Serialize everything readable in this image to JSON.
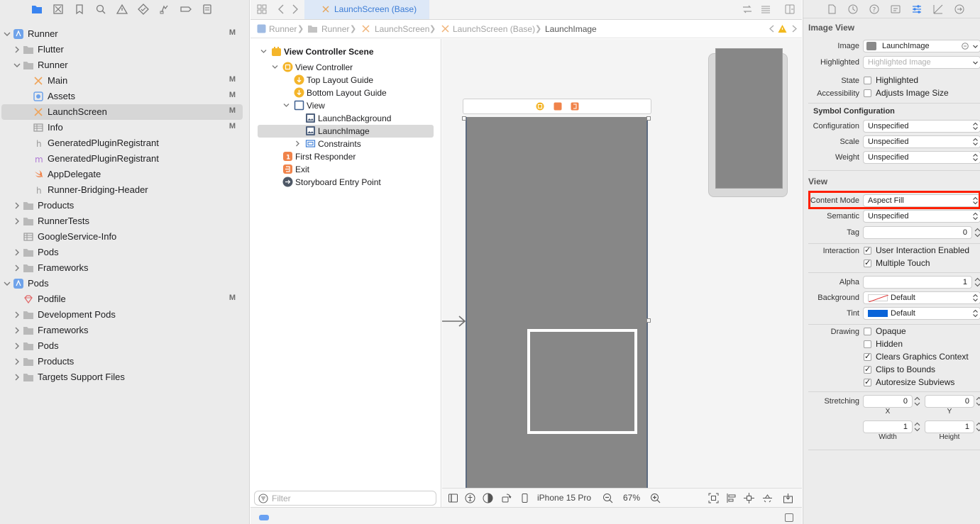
{
  "navigator": {
    "toolbar_icons": [
      "folder-icon",
      "source-control-icon",
      "bookmark-icon",
      "find-icon",
      "issue-icon",
      "test-icon",
      "debug-icon",
      "breakpoint-icon",
      "report-icon"
    ],
    "items": [
      {
        "label": "Runner",
        "badge": "M",
        "icon": "project-icon"
      },
      {
        "label": "Flutter",
        "badge": "",
        "icon": "folder-icon"
      },
      {
        "label": "Runner",
        "badge": "",
        "icon": "folder-icon"
      },
      {
        "label": "Main",
        "badge": "M",
        "icon": "storyboard-icon"
      },
      {
        "label": "Assets",
        "badge": "M",
        "icon": "asset-catalog-icon"
      },
      {
        "label": "LaunchScreen",
        "badge": "M",
        "icon": "storyboard-icon"
      },
      {
        "label": "Info",
        "badge": "M",
        "icon": "plist-icon"
      },
      {
        "label": "GeneratedPluginRegistrant",
        "badge": "",
        "icon": "header-file-icon"
      },
      {
        "label": "GeneratedPluginRegistrant",
        "badge": "",
        "icon": "objc-file-icon"
      },
      {
        "label": "AppDelegate",
        "badge": "",
        "icon": "swift-file-icon"
      },
      {
        "label": "Runner-Bridging-Header",
        "badge": "",
        "icon": "header-file-icon"
      },
      {
        "label": "Products",
        "badge": "",
        "icon": "folder-icon"
      },
      {
        "label": "RunnerTests",
        "badge": "",
        "icon": "folder-icon"
      },
      {
        "label": "GoogleService-Info",
        "badge": "",
        "icon": "plist-icon"
      },
      {
        "label": "Pods",
        "badge": "",
        "icon": "folder-icon"
      },
      {
        "label": "Frameworks",
        "badge": "",
        "icon": "folder-icon"
      },
      {
        "label": "Pods",
        "badge": "",
        "icon": "project-icon"
      },
      {
        "label": "Podfile",
        "badge": "M",
        "icon": "ruby-file-icon"
      },
      {
        "label": "Development Pods",
        "badge": "",
        "icon": "folder-icon"
      },
      {
        "label": "Frameworks",
        "badge": "",
        "icon": "folder-icon"
      },
      {
        "label": "Pods",
        "badge": "",
        "icon": "folder-icon"
      },
      {
        "label": "Products",
        "badge": "",
        "icon": "folder-icon"
      },
      {
        "label": "Targets Support Files",
        "badge": "",
        "icon": "folder-icon"
      }
    ]
  },
  "editor": {
    "tab_title": "LaunchScreen (Base)",
    "breadcrumbs": [
      "Runner",
      "Runner",
      "LaunchScreen",
      "LaunchScreen (Base)",
      "LaunchImage"
    ]
  },
  "outline": {
    "items": [
      {
        "label": "View Controller Scene",
        "icon": "scene-icon"
      },
      {
        "label": "View Controller",
        "icon": "view-controller-icon"
      },
      {
        "label": "Top Layout Guide",
        "icon": "layout-guide-icon"
      },
      {
        "label": "Bottom Layout Guide",
        "icon": "layout-guide-icon"
      },
      {
        "label": "View",
        "icon": "view-icon"
      },
      {
        "label": "LaunchBackground",
        "icon": "image-view-icon"
      },
      {
        "label": "LaunchImage",
        "icon": "image-view-icon"
      },
      {
        "label": "Constraints",
        "icon": "constraints-icon"
      },
      {
        "label": "First Responder",
        "icon": "first-responder-icon"
      },
      {
        "label": "Exit",
        "icon": "exit-icon"
      },
      {
        "label": "Storyboard Entry Point",
        "icon": "entry-point-icon"
      }
    ],
    "filter_placeholder": "Filter"
  },
  "canvas": {
    "device": "iPhone 15 Pro",
    "zoom": "67%"
  },
  "inspector": {
    "image_view": {
      "title": "Image View",
      "image_label": "Image",
      "image_value": "LaunchImage",
      "highlighted_label": "Highlighted",
      "highlighted_placeholder": "Highlighted Image",
      "state_label": "State",
      "state_option": "Highlighted",
      "accessibility_label": "Accessibility",
      "accessibility_option": "Adjusts Image Size"
    },
    "symbol": {
      "title": "Symbol Configuration",
      "configuration_label": "Configuration",
      "configuration_value": "Unspecified",
      "scale_label": "Scale",
      "scale_value": "Unspecified",
      "weight_label": "Weight",
      "weight_value": "Unspecified"
    },
    "view": {
      "title": "View",
      "content_mode_label": "Content Mode",
      "content_mode_value": "Aspect Fill",
      "semantic_label": "Semantic",
      "semantic_value": "Unspecified",
      "tag_label": "Tag",
      "tag_value": "0",
      "interaction_label": "Interaction",
      "user_interaction": "User Interaction Enabled",
      "multiple_touch": "Multiple Touch",
      "alpha_label": "Alpha",
      "alpha_value": "1",
      "background_label": "Background",
      "background_value": "Default",
      "tint_label": "Tint",
      "tint_value": "Default",
      "tint_color": "#0a64d8",
      "drawing_label": "Drawing",
      "opaque": "Opaque",
      "hidden": "Hidden",
      "clears_graphics": "Clears Graphics Context",
      "clips_to_bounds": "Clips to Bounds",
      "autoresize": "Autoresize Subviews",
      "stretching_label": "Stretching",
      "stretch_x": "0",
      "stretch_y": "0",
      "stretch_width": "1",
      "stretch_height": "1",
      "x_label": "X",
      "y_label": "Y",
      "width_label": "Width",
      "height_label": "Height"
    },
    "highlight_color": "#ff1f00"
  }
}
